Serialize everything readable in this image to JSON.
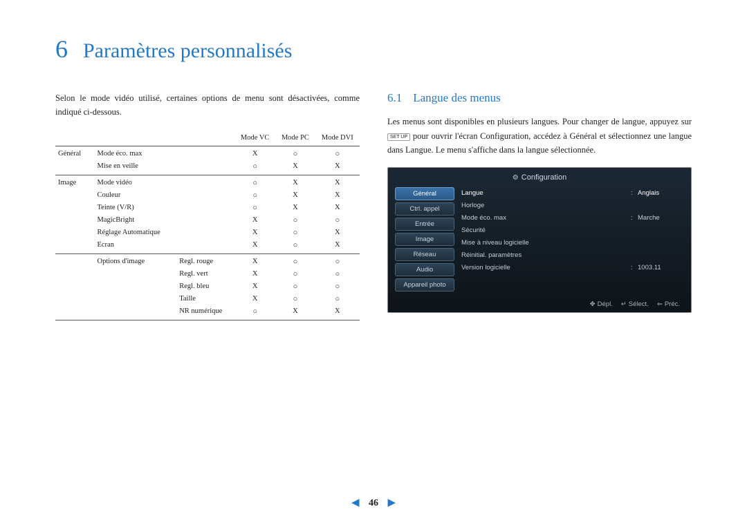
{
  "chapter": {
    "number": "6",
    "title": "Paramètres personnalisés"
  },
  "leftColumn": {
    "intro": "Selon le mode vidéo utilisé, certaines options de menu sont désactivées, comme indiqué ci-dessous."
  },
  "table": {
    "headers": {
      "c3": "Mode VC",
      "c4": "Mode PC",
      "c5": "Mode DVI"
    },
    "rows": [
      {
        "group": "Général",
        "item": "Mode éco. max",
        "sub": "",
        "vc": "X",
        "pc": "○",
        "dvi": "○",
        "section_start": true
      },
      {
        "group": "",
        "item": "Mise en veille",
        "sub": "",
        "vc": "○",
        "pc": "X",
        "dvi": "X",
        "lastrow": true
      },
      {
        "group": "Image",
        "item": "Mode vidéo",
        "sub": "",
        "vc": "○",
        "pc": "X",
        "dvi": "X",
        "section_start": true
      },
      {
        "group": "",
        "item": "Couleur",
        "sub": "",
        "vc": "○",
        "pc": "X",
        "dvi": "X"
      },
      {
        "group": "",
        "item": "Teinte (V/R)",
        "sub": "",
        "vc": "○",
        "pc": "X",
        "dvi": "X"
      },
      {
        "group": "",
        "item": "MagicBright",
        "sub": "",
        "vc": "X",
        "pc": "○",
        "dvi": "○"
      },
      {
        "group": "",
        "item": "Réglage Automatique",
        "sub": "",
        "vc": "X",
        "pc": "○",
        "dvi": "X"
      },
      {
        "group": "",
        "item": "Ecran",
        "sub": "",
        "vc": "X",
        "pc": "○",
        "dvi": "X",
        "lastrow": true
      },
      {
        "group": "",
        "item": "Options d'image",
        "sub": "Regl. rouge",
        "vc": "X",
        "pc": "○",
        "dvi": "○",
        "section_start": true
      },
      {
        "group": "",
        "item": "",
        "sub": "Regl. vert",
        "vc": "X",
        "pc": "○",
        "dvi": "○"
      },
      {
        "group": "",
        "item": "",
        "sub": "Regl. bleu",
        "vc": "X",
        "pc": "○",
        "dvi": "○"
      },
      {
        "group": "",
        "item": "",
        "sub": "Taille",
        "vc": "X",
        "pc": "○",
        "dvi": "○"
      },
      {
        "group": "",
        "item": "",
        "sub": "NR numérique",
        "vc": "○",
        "pc": "X",
        "dvi": "X",
        "lastrow": true
      }
    ]
  },
  "rightColumn": {
    "section": {
      "number": "6.1",
      "title": "Langue des menus"
    },
    "text_pre": "Les menus sont disponibles en plusieurs langues. Pour changer de langue, appuyez sur ",
    "text_key": "SET UP",
    "text_post": " pour ouvrir l'écran Configuration, accédez à Général et sélectionnez une langue dans Langue. Le menu s'affiche dans la langue sélectionnée."
  },
  "osd": {
    "title": "Configuration",
    "menu": [
      {
        "label": "Général",
        "selected": true
      },
      {
        "label": "Ctrl. appel"
      },
      {
        "label": "Entrée"
      },
      {
        "label": "Image"
      },
      {
        "label": "Réseau"
      },
      {
        "label": "Audio"
      },
      {
        "label": "Appareil photo"
      }
    ],
    "content": [
      {
        "label": "Langue",
        "value": "Anglais",
        "selected": true
      },
      {
        "label": "Horloge",
        "value": ""
      },
      {
        "label": "Mode éco. max",
        "value": "Marche"
      },
      {
        "label": "Sécurité",
        "value": ""
      },
      {
        "label": "Mise à niveau logicielle",
        "value": ""
      },
      {
        "label": "Réinitial. paramètres",
        "value": ""
      },
      {
        "label": "Version logicielle",
        "value": "1003.11"
      }
    ],
    "footer": {
      "move": "Dépl.",
      "select": "Sélect.",
      "prev": "Préc."
    }
  },
  "pager": {
    "page": "46"
  }
}
